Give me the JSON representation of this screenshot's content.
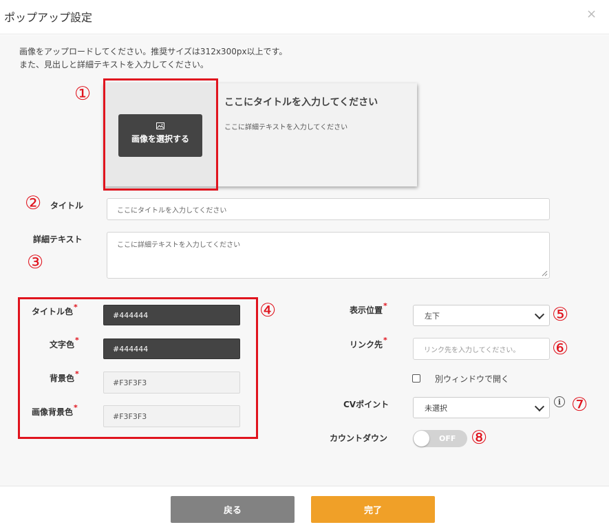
{
  "header": {
    "title": "ポップアップ設定",
    "close_glyph": "×"
  },
  "instructions": {
    "line1": "画像をアップロードしてください。推奨サイズは312x300px以上です。",
    "line2": "また、見出しと詳細テキストを入力してください。"
  },
  "markers": [
    "①",
    "②",
    "③",
    "④",
    "⑤",
    "⑥",
    "⑦",
    "⑧"
  ],
  "preview": {
    "image_button_label": "画像を選択する",
    "image_icon": "image-icon",
    "title": "ここにタイトルを入力してください",
    "text": "ここに詳細テキストを入力してください"
  },
  "form": {
    "title_label": "タイトル",
    "title_placeholder": "ここにタイトルを入力してください",
    "detail_label": "詳細テキスト",
    "detail_placeholder": "ここに詳細テキストを入力してください",
    "colors": [
      {
        "label": "タイトル色",
        "required": "*",
        "value": "#444444"
      },
      {
        "label": "文字色",
        "required": "*",
        "value": "#444444"
      },
      {
        "label": "背景色",
        "required": "*",
        "value": "#F3F3F3"
      },
      {
        "label": "画像背景色",
        "required": "*",
        "value": "#F3F3F3"
      }
    ],
    "position": {
      "label": "表示位置",
      "required": "*",
      "value": "左下"
    },
    "link": {
      "label": "リンク先",
      "required": "*",
      "placeholder": "リンク先を入力してください。"
    },
    "new_window": {
      "label": "別ウィンドウで開く",
      "checked": false
    },
    "cv_point": {
      "label": "CVポイント",
      "value": "未選択",
      "info_icon": "info-icon"
    },
    "countdown": {
      "label": "カウントダウン",
      "state": "OFF"
    }
  },
  "footer": {
    "back_label": "戻る",
    "done_label": "完了"
  },
  "colors": {
    "accent_red": "#e0141e",
    "done": "#f0a028",
    "back": "#828282",
    "dark_input": "#444444"
  }
}
